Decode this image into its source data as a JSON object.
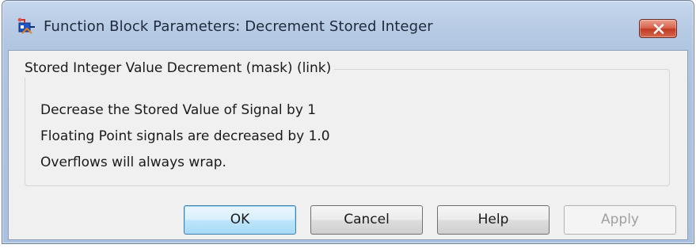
{
  "window": {
    "title": "Function Block Parameters: Decrement Stored Integer",
    "icon": "simulink-block-icon",
    "close_icon": "close-icon"
  },
  "group": {
    "legend": "Stored Integer Value Decrement (mask) (link)",
    "lines": [
      "Decrease the Stored Value of Signal by 1",
      "Floating Point signals are decreased by 1.0",
      "Overflows will always wrap."
    ]
  },
  "buttons": {
    "ok": "OK",
    "cancel": "Cancel",
    "help": "Help",
    "apply": "Apply",
    "apply_enabled": false
  },
  "colors": {
    "titlebar": "#b6cae4",
    "close": "#c23a24",
    "panel": "#f0f0f0",
    "ok_border": "#3c7fb1"
  }
}
